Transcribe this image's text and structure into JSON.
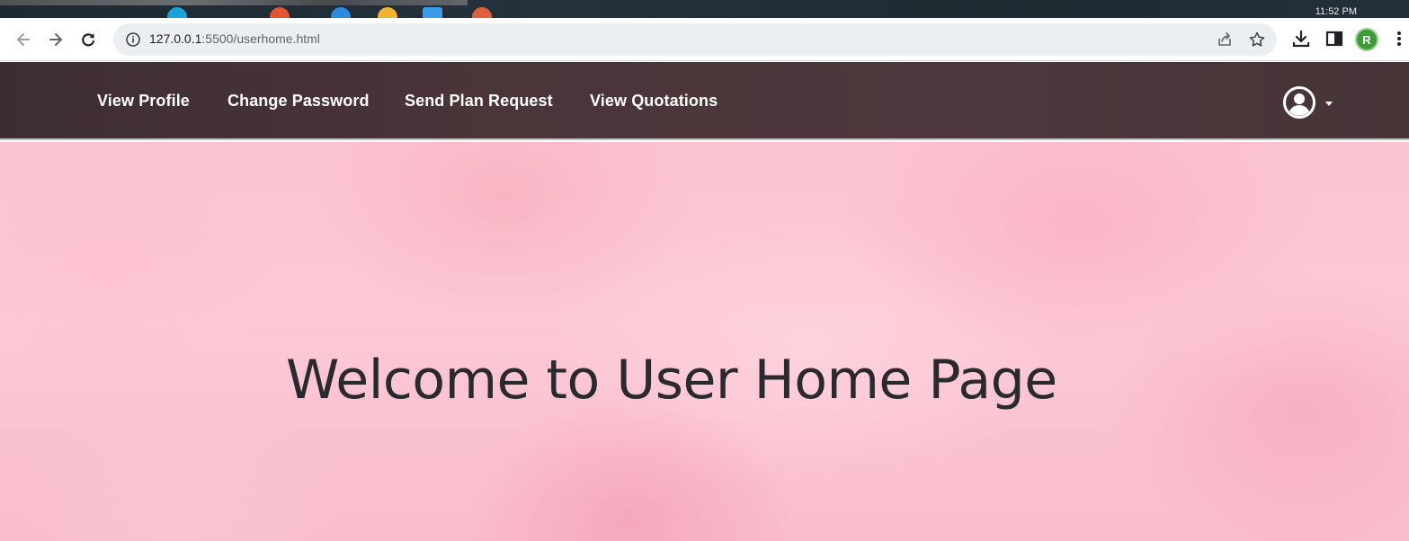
{
  "os": {
    "clock": "11:52 PM"
  },
  "browser": {
    "url_host": "127.0.0.1",
    "url_path": ":5500/userhome.html",
    "profile_initial": "R",
    "icons": [
      "back-arrow-icon",
      "forward-arrow-icon",
      "reload-icon",
      "info-icon",
      "share-icon",
      "star-icon",
      "download-icon",
      "side-panel-icon",
      "kebab-menu-icon"
    ]
  },
  "navbar": {
    "links": [
      {
        "label": "View Profile"
      },
      {
        "label": "Change Password"
      },
      {
        "label": "Send Plan Request"
      },
      {
        "label": "View Quotations"
      }
    ],
    "user_icon": "user-circle-icon"
  },
  "hero": {
    "heading": "Welcome to User Home Page"
  },
  "colors": {
    "navbar_bg": "#4a3539",
    "hero_bg": "#fcc9d6",
    "heading_text": "#2a2a2e",
    "profile_badge": "#3e9b3a"
  }
}
